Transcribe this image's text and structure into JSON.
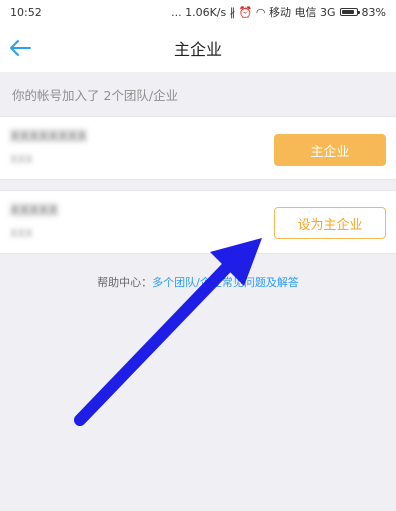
{
  "status_bar": {
    "time": "10:52",
    "right_text": "... 1.06K/s ∦ ⏰ ◠ 移动 电信 3G",
    "battery": "83%",
    "battery_level": 0.83
  },
  "nav": {
    "title": "主企业",
    "back_icon": "back-arrow-icon",
    "accent_color": "#2a9df4"
  },
  "info": {
    "text": "你的帐号加入了 2个团队/企业"
  },
  "companies": [
    {
      "name": "XXXXXXXX",
      "sub": "XXX",
      "button_label": "主企业",
      "button_style": "filled",
      "button_color": "#f7b955"
    },
    {
      "name": "XXXXX",
      "sub": "XXX",
      "button_label": "设为主企业",
      "button_style": "outline",
      "button_color": "#f5a623"
    }
  ],
  "help": {
    "prefix": "帮助中心：",
    "link": "多个团队/企业常见问题及解答"
  },
  "annotation": {
    "color": "#1e1ee6",
    "icon": "pointer-arrow"
  }
}
